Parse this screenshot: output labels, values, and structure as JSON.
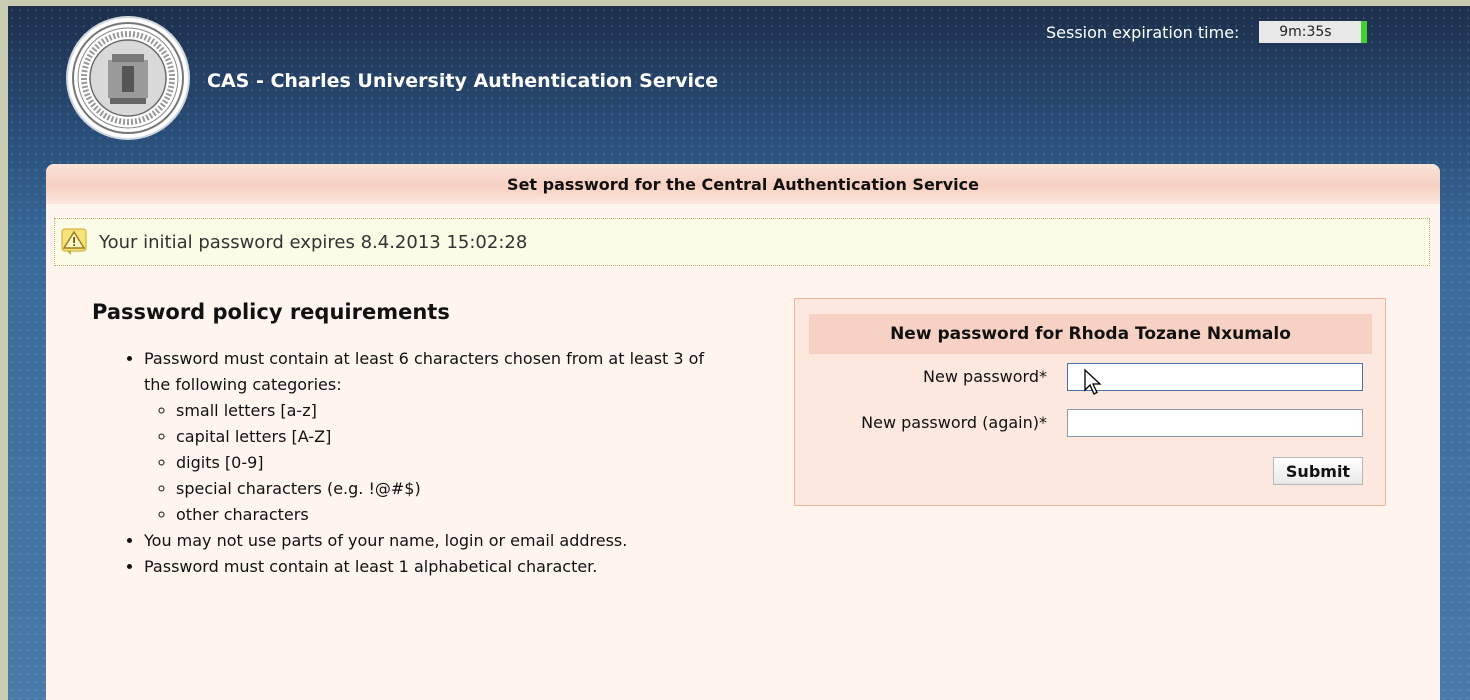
{
  "header": {
    "title": "CAS - Charles University Authentication Service",
    "session_label": "Session expiration time:",
    "session_timer": "9m:35s",
    "logo_icon": "university-seal-icon"
  },
  "panel": {
    "title": "Set password for the Central Authentication Service",
    "alert": {
      "icon": "warning-icon",
      "text": "Your initial password expires 8.4.2013 15:02:28"
    },
    "policy": {
      "heading": "Password policy requirements",
      "rule1": "Password must contain at least 6 characters chosen from at least 3 of the following categories:",
      "categories": [
        "small letters [a-z]",
        "capital letters [A-Z]",
        "digits [0-9]",
        "special characters (e.g. !@#$)",
        "other characters"
      ],
      "rule2": "You may not use parts of your name, login or email address.",
      "rule3": "Password must contain at least 1 alphabetical character."
    },
    "form": {
      "heading": "New password for Rhoda Tozane Nxumalo",
      "new_password_label": "New password*",
      "new_password_again_label": "New password (again)*",
      "submit_label": "Submit"
    }
  },
  "colors": {
    "timer_indicator": "#41d131",
    "panel_background": "#fff4ee"
  }
}
